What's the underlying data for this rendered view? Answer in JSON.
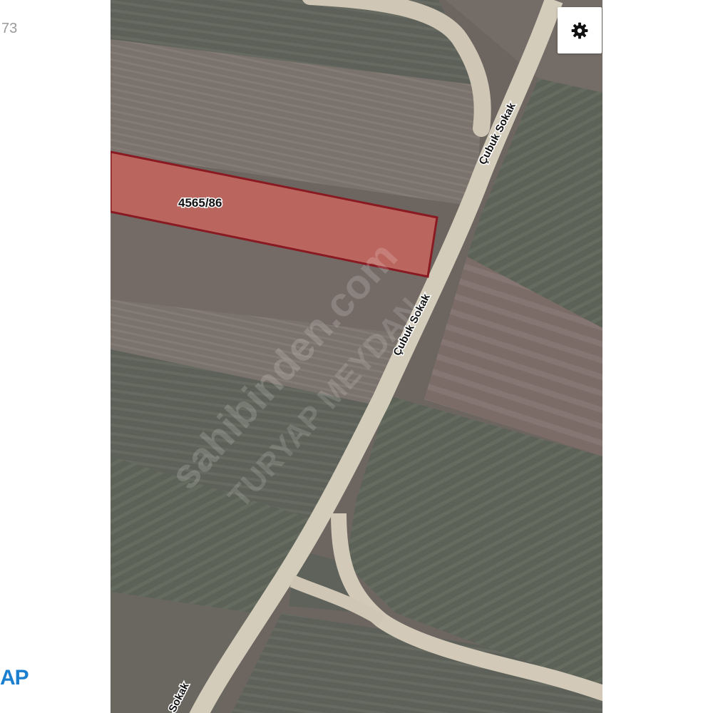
{
  "left_panel": {
    "corner_number": "73",
    "logo_fragment": "AP"
  },
  "map": {
    "parcel": {
      "label": "4565/86",
      "fill": "#c8665f",
      "stroke": "#8a1a22"
    },
    "roads": [
      {
        "name": "Çubuk Sokak"
      },
      {
        "name": "Çubuk Sokak"
      },
      {
        "name": "Sokak"
      }
    ],
    "watermarks": [
      "sahibinden.com",
      "TURYAP MEYDAN"
    ]
  },
  "controls": {
    "settings_icon": "gear-icon"
  }
}
